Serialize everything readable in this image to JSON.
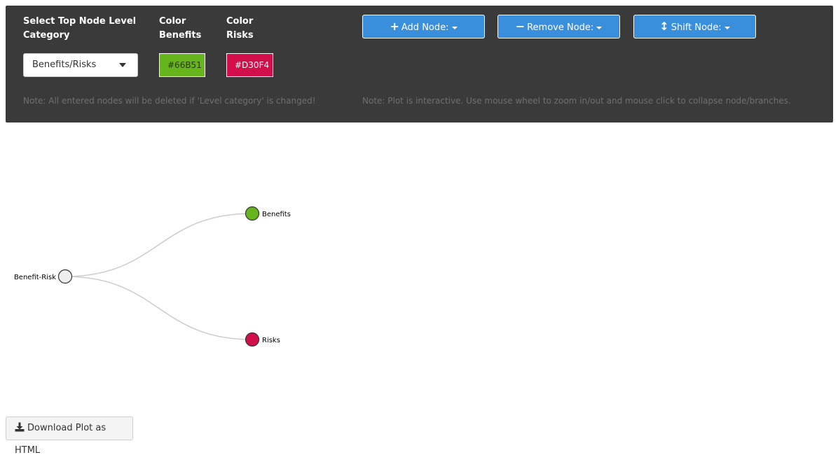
{
  "controls": {
    "top_level_label": "Select Top Node Level Category",
    "top_level_value": "Benefits/Risks",
    "color_benefits_label": "Color Benefits",
    "color_benefits_value": "#66B51",
    "color_benefits_hex": "#66b51c",
    "color_risks_label": "Color Risks",
    "color_risks_value": "#D30F4",
    "color_risks_hex": "#d30f4b"
  },
  "buttons": {
    "add_node": "Add Node:",
    "remove_node": "Remove Node:",
    "shift_node": "Shift Node:"
  },
  "notes": {
    "level_note": "Note: All entered nodes will be deleted if 'Level category' is changed!",
    "plot_note": "Note: Plot is interactive. Use mouse wheel to zoom in/out and mouse click to collapse node/branches."
  },
  "tree": {
    "root": {
      "label": "Benefit-Risk",
      "color": "#eeeeee"
    },
    "children": [
      {
        "label": "Benefits",
        "color": "#66b51c"
      },
      {
        "label": "Risks",
        "color": "#d30f4b"
      }
    ]
  },
  "download": {
    "label": "Download Plot as HTML"
  }
}
